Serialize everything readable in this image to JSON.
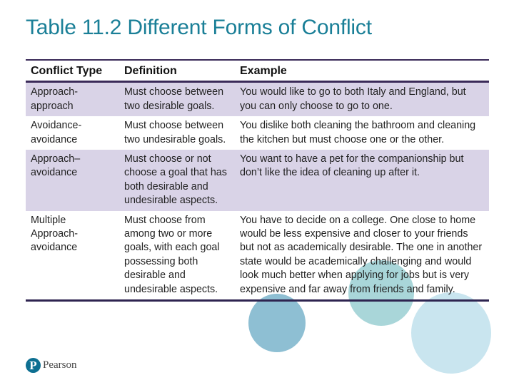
{
  "title": "Table 11.2 Different Forms of Conflict",
  "table": {
    "headers": [
      "Conflict Type",
      "Definition",
      "Example"
    ],
    "rows": [
      {
        "type": "Approach-approach",
        "definition": "Must choose between two desirable goals.",
        "example": "You would like to go to both Italy and England, but you can only choose to go to one."
      },
      {
        "type": "Avoidance-avoidance",
        "definition": "Must choose between two undesirable goals.",
        "example": "You dislike both cleaning the bathroom and cleaning the kitchen but must choose one or the other."
      },
      {
        "type": "Approach–avoidance",
        "definition": "Must choose or not choose a goal that has both desirable and undesirable aspects.",
        "example": "You want to have a pet for the companionship but don’t like the idea of cleaning up after it."
      },
      {
        "type": "Multiple Approach-avoidance",
        "definition": "Must choose from among two or more goals, with each goal possessing both desirable and undesirable aspects.",
        "example": "You have to decide on a college. One close to home would be less expensive and closer to your friends but not as academically desirable. The one in another state would be academically challenging and would look much better when applying for jobs but is very expensive and far away from friends and family."
      }
    ]
  },
  "footer": {
    "logo_mark": "P",
    "logo_text": "Pearson",
    "logo_icon": "pearson-logo-icon"
  },
  "colors": {
    "title": "#1a7f97",
    "row_shade": "#d9d3e7",
    "rule": "#3a2a58",
    "logo": "#0d6f91"
  }
}
